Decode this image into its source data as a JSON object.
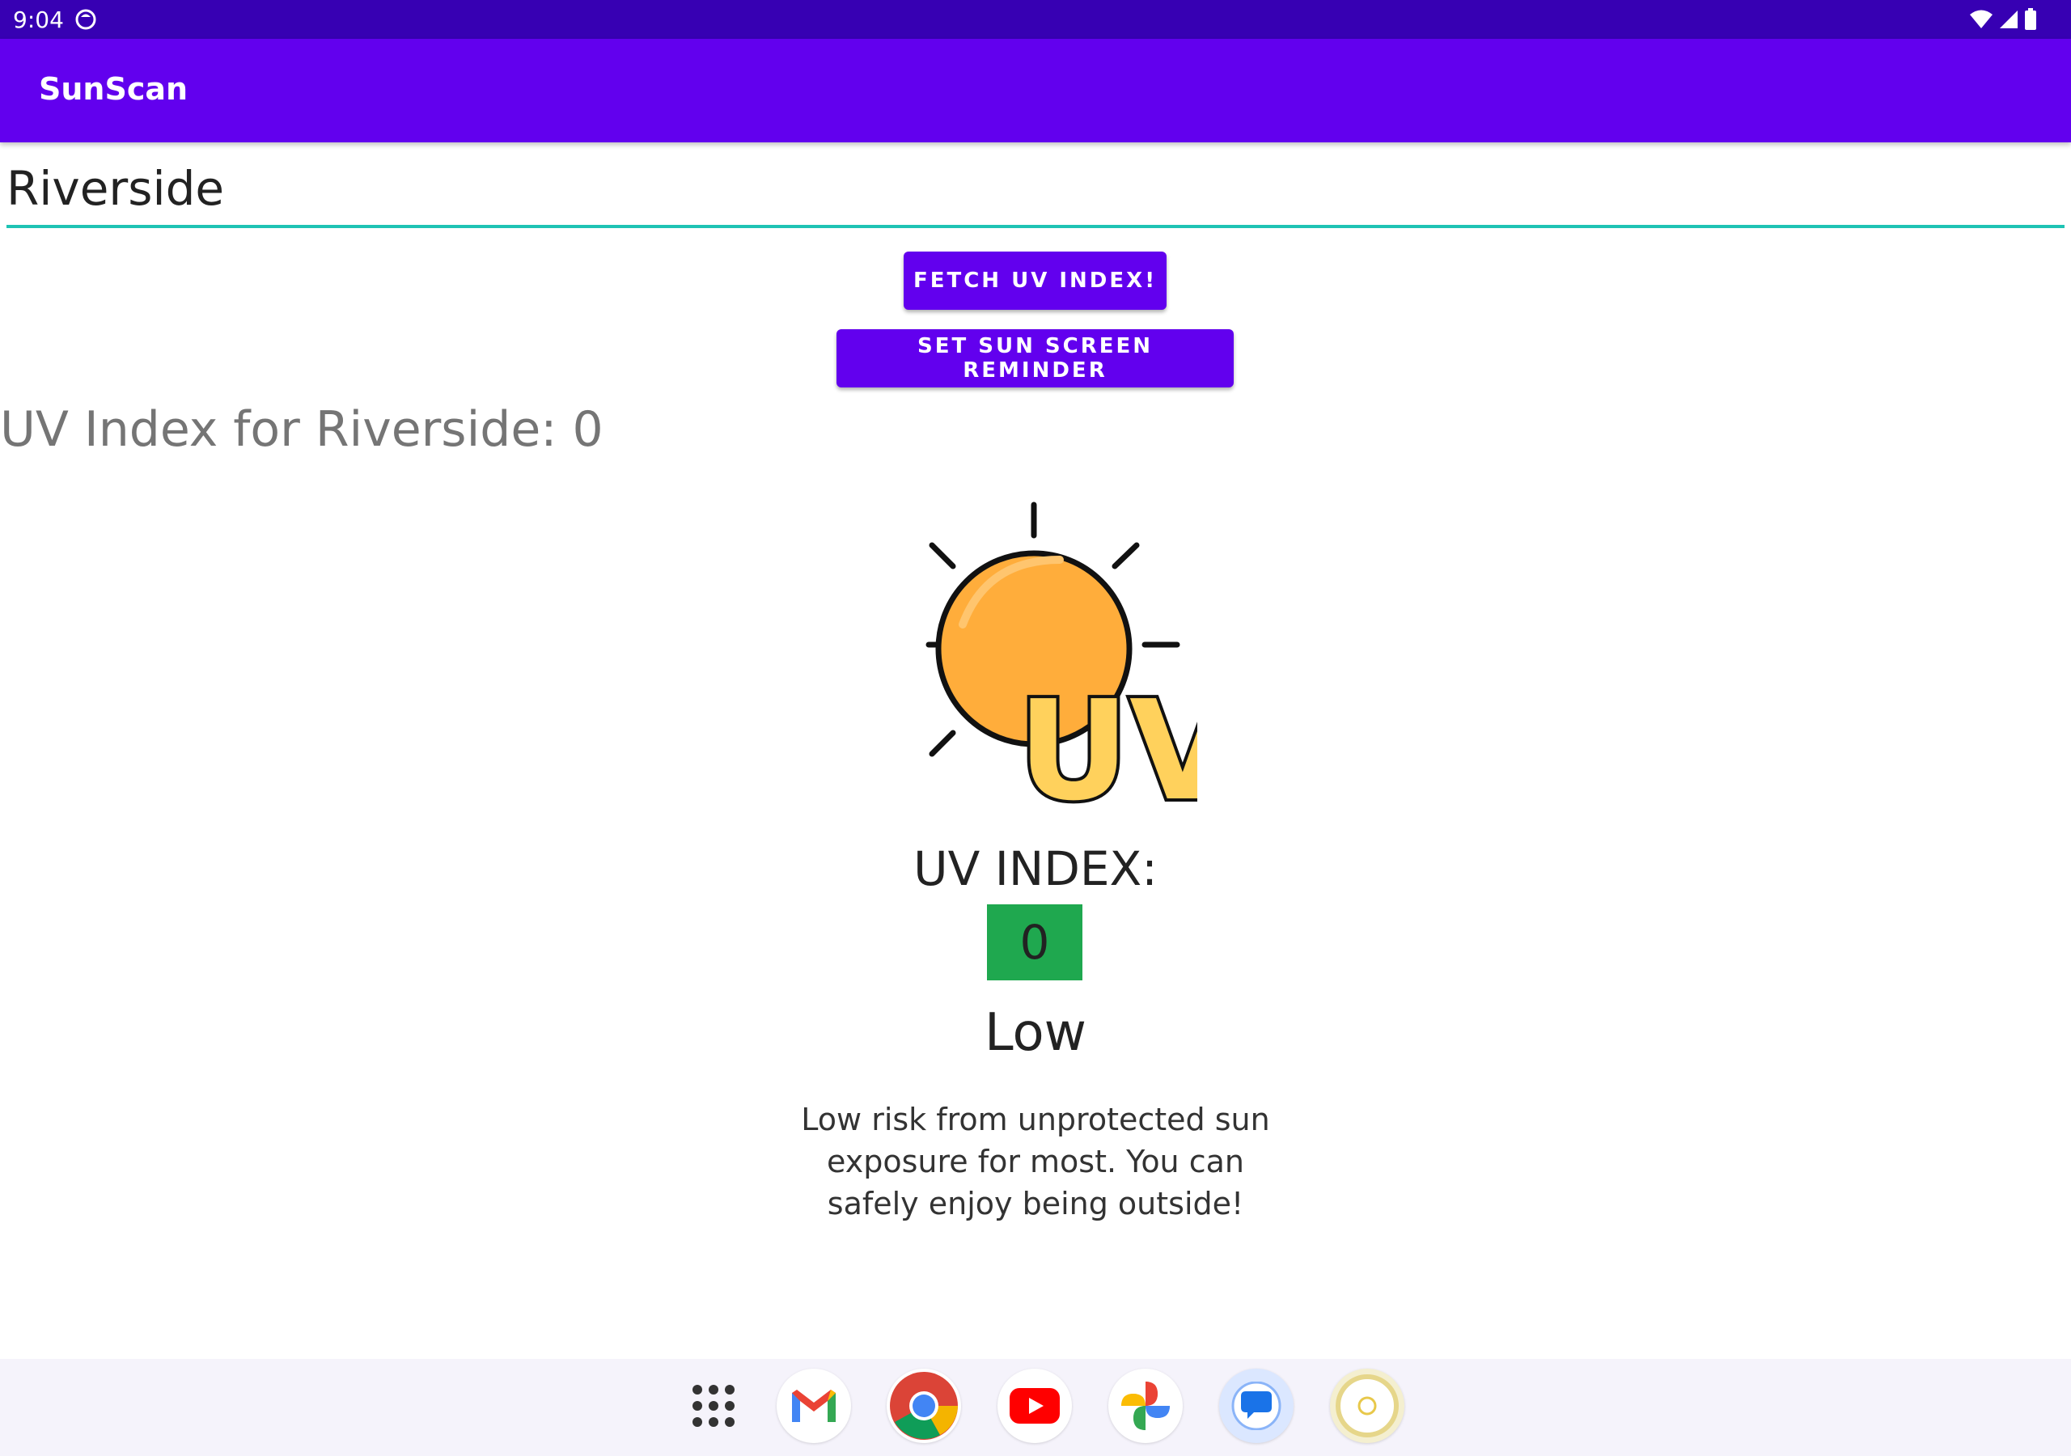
{
  "status_bar": {
    "time": "9:04"
  },
  "app_bar": {
    "title": "SunScan"
  },
  "city_input": {
    "value": "Riverside"
  },
  "buttons": {
    "fetch": "FETCH UV INDEX!",
    "reminder": "SET SUN SCREEN REMINDER"
  },
  "result": {
    "text": "UV Index for Riverside: 0"
  },
  "uv_card": {
    "logo_text": "UV",
    "index_label": "UV INDEX:",
    "index_value": "0",
    "level": "Low",
    "description": "Low risk from unprotected sun exposure for most. You can safely enjoy being outside!"
  },
  "colors": {
    "status_bar": "#3700b3",
    "app_bar": "#6200ee",
    "accent": "#1ec3b4",
    "uv_low": "#1fa84f",
    "sun": "#ffad3b"
  },
  "dock": {
    "icons": [
      "apps-grid-icon",
      "gmail-icon",
      "chrome-icon",
      "youtube-icon",
      "photos-icon",
      "messages-icon",
      "sunscan-icon"
    ]
  }
}
